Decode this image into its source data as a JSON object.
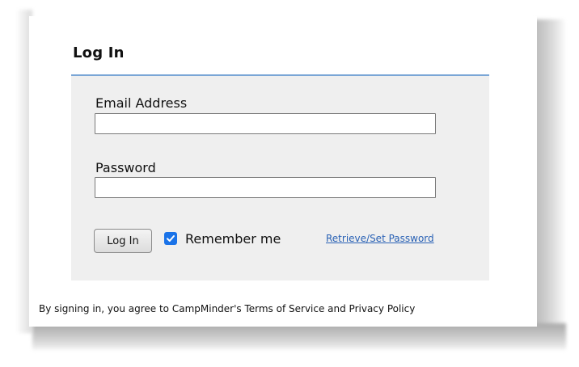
{
  "login": {
    "title": "Log In",
    "email_label": "Email Address",
    "email_value": "",
    "password_label": "Password",
    "password_value": "",
    "submit_label": "Log In",
    "remember_label": "Remember me",
    "remember_checked": true,
    "retrieve_link": "Retrieve/Set Password"
  },
  "footer": {
    "terms_text": "By signing in, you agree to CampMinder's Terms of Service and Privacy Policy"
  },
  "colors": {
    "accent_rule": "#7aa6d6",
    "checkbox": "#1a73e8",
    "link": "#2a62b5",
    "panel": "#efefef"
  }
}
